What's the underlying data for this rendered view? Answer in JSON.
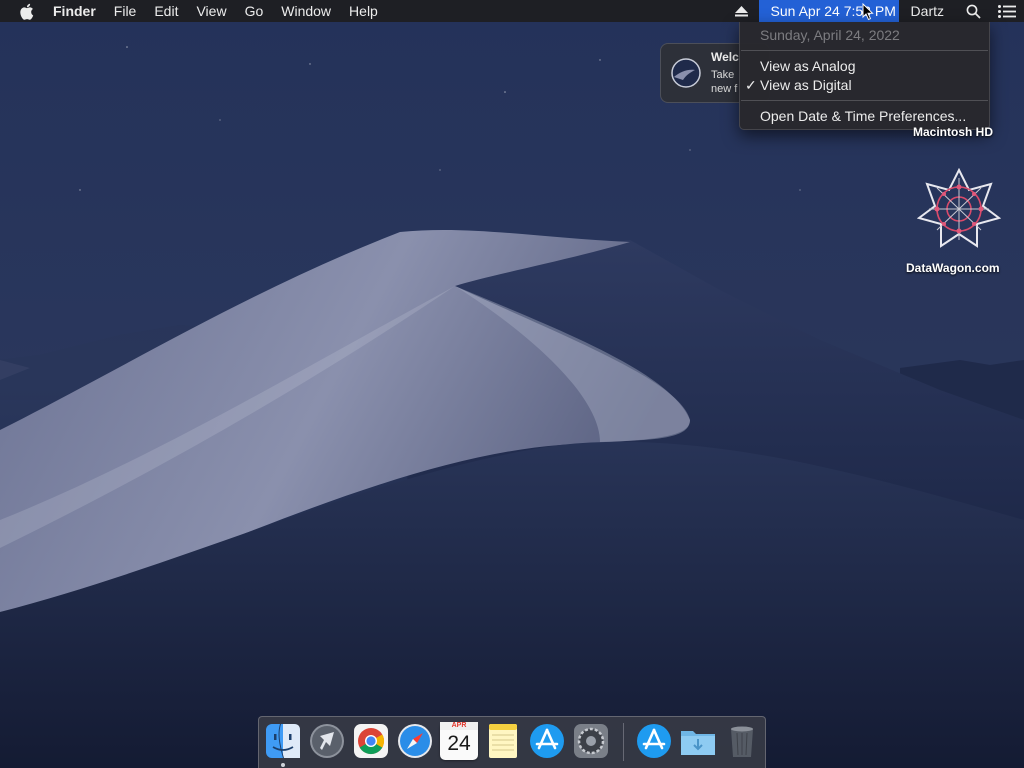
{
  "menubar": {
    "app_name": "Finder",
    "menus": [
      "File",
      "Edit",
      "View",
      "Go",
      "Window",
      "Help"
    ],
    "clock": "Sun Apr 24  7:53 PM",
    "user": "Dartz",
    "icons": [
      "apple-icon",
      "eject-icon",
      "spotlight-search-icon",
      "notification-center-icon"
    ]
  },
  "clock_menu": {
    "date": "Sunday, April 24, 2022",
    "view_analog": "View as Analog",
    "view_digital": "View as Digital",
    "checkmark": "✓",
    "preferences": "Open Date & Time Preferences..."
  },
  "notification": {
    "title": "Welc",
    "body_line1": "Take",
    "body_line2": "new f"
  },
  "desktop": {
    "drive_label": "Macintosh HD",
    "datawagon_label": "DataWagon.com"
  },
  "dock": {
    "items": [
      "finder-icon",
      "launchpad-icon",
      "chrome-icon",
      "safari-icon",
      "calendar-icon",
      "notes-icon",
      "app-store-icon",
      "system-preferences-icon",
      "app-store-download-icon",
      "downloads-folder-icon",
      "trash-icon"
    ],
    "calendar_month": "APR",
    "calendar_day": "24"
  },
  "colors": {
    "menu_highlight": "#2361d6",
    "menubar_bg": "#1e1e22",
    "wallpaper_sky": "#1e2a4a"
  }
}
